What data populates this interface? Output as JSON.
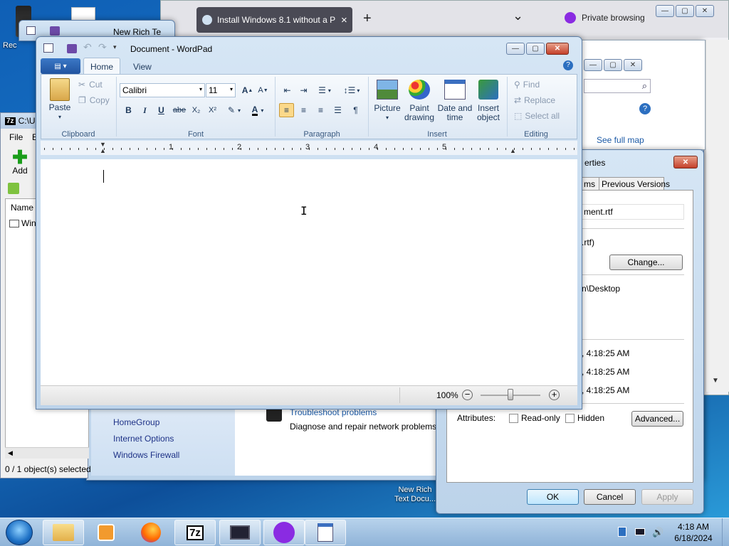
{
  "desktop": {
    "icon_label_top": "Rec",
    "icon_bottom_label_line1": "New Rich",
    "icon_bottom_label_line2": "Text Docu..."
  },
  "browser": {
    "tab_title": "Install Windows 8.1 without a P",
    "tab_close": "×",
    "new_tab": "+",
    "dropdown": "⌄",
    "private_label": "Private browsing"
  },
  "back_wordpad": {
    "title": "New Rich Te"
  },
  "sevenzip": {
    "title": "C:\\U",
    "menu_file": "File",
    "menu_edit": "E",
    "add_label": "Add",
    "col_name": "Name",
    "row1": "Win",
    "status": "0 / 1 object(s) selected"
  },
  "control_panel": {
    "see_full_map": "See full map",
    "links": [
      "HomeGroup",
      "Internet Options",
      "Windows Firewall"
    ],
    "troubleshoot": "Troubleshoot problems",
    "diagnose": "Diagnose and repair network problems,"
  },
  "properties": {
    "title": "erties",
    "tabs": [
      "ms",
      "Previous Versions"
    ],
    "filename": "ment.rtf",
    "type": ".rtf)",
    "change_button": "Change...",
    "location": "n\\Desktop",
    "times": [
      ", 4:18:25 AM",
      ", 4:18:25 AM",
      ", 4:18:25 AM"
    ],
    "attributes_label": "Attributes:",
    "readonly_label": "Read-only",
    "hidden_label": "Hidden",
    "advanced_button": "Advanced...",
    "ok_button": "OK",
    "cancel_button": "Cancel",
    "apply_button": "Apply"
  },
  "wordpad": {
    "title": "Document - WordPad",
    "tab_home": "Home",
    "tab_view": "View",
    "paste": "Paste",
    "cut": "Cut",
    "copy": "Copy",
    "font_name": "Calibri",
    "font_size": "11",
    "bold": "B",
    "italic": "I",
    "underline": "U",
    "strike": "abe",
    "subscript": "X₂",
    "superscript": "X²",
    "picture": "Picture",
    "paint_line1": "Paint",
    "paint_line2": "drawing",
    "datetime_line1": "Date and",
    "datetime_line2": "time",
    "insert_obj_line1": "Insert",
    "insert_obj_line2": "object",
    "find": "Find",
    "replace": "Replace",
    "select_all": "Select all",
    "groups": [
      "Clipboard",
      "Font",
      "Paragraph",
      "Insert",
      "Editing"
    ],
    "ruler_numbers": [
      "1",
      "2",
      "3",
      "4",
      "5"
    ],
    "zoom_level": "100%",
    "zoom_fraction": 0.5
  },
  "clock": {
    "time": "4:18 AM",
    "date": "6/18/2024"
  },
  "colors": {
    "accent": "#3c7fb1",
    "ribbon_tab": "#2b5797",
    "link": "#1c5aa6",
    "private": "#8a2be2"
  }
}
